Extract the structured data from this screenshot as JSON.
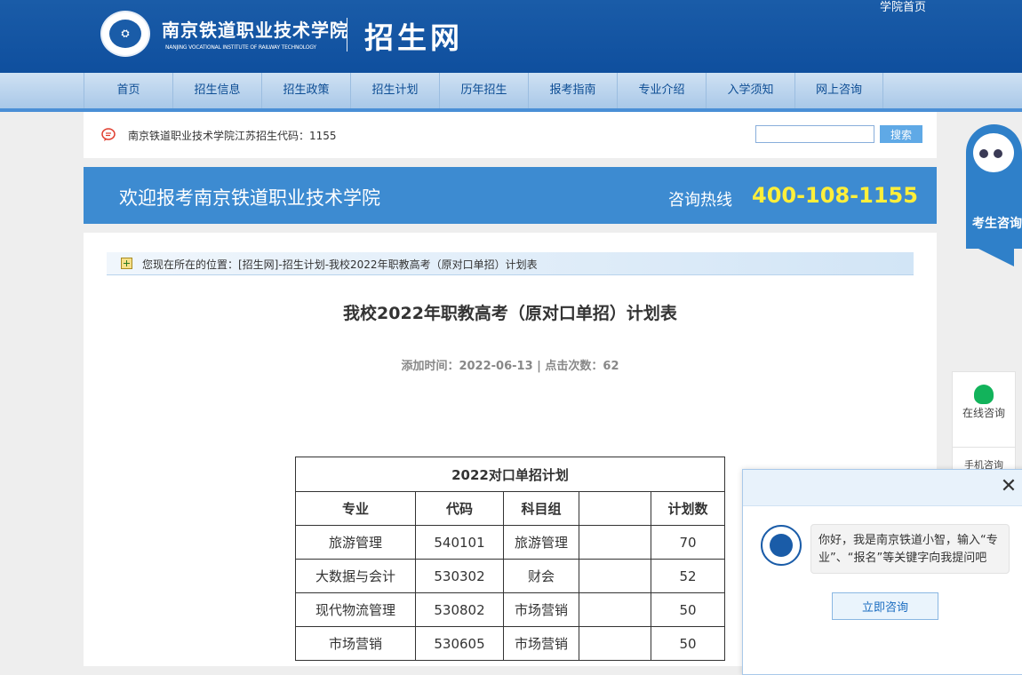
{
  "header": {
    "logo_icon": "school-seal-icon",
    "school_name_cn": "南京铁道职业技术学院",
    "school_name_en": "NANJING VOCATIONAL INSTITUTE OF RAILWAY TECHNOLOGY",
    "site_name": "招生网",
    "home_link": "学院首页"
  },
  "nav": {
    "items": [
      "首页",
      "招生信息",
      "招生政策",
      "招生计划",
      "历年招生",
      "报考指南",
      "专业介绍",
      "入学须知",
      "网上咨询"
    ]
  },
  "notice": {
    "icon": "speech-bubble-icon",
    "text": "南京铁道职业技术学院江苏招生代码：1155",
    "search_placeholder": "",
    "search_button": "搜索"
  },
  "banner": {
    "title": "欢迎报考南京铁道职业技术学院",
    "hotline_label": "咨询热线",
    "hotline_number": "400-108-1155"
  },
  "breadcrumb": {
    "icon": "plus-folder-icon",
    "text": "您现在所在的位置：[招生网]-招生计划-我校2022年职教高考（原对口单招）计划表"
  },
  "article": {
    "title": "我校2022年职教高考（原对口单招）计划表",
    "meta": "添加时间：2022-06-13 | 点击次数：62"
  },
  "table": {
    "caption": "2022对口单招计划",
    "headers": [
      "专业",
      "代码",
      "科目组",
      "",
      "计划数"
    ],
    "rows": [
      [
        "旅游管理",
        "540101",
        "旅游管理",
        "",
        "70"
      ],
      [
        "大数据与会计",
        "530302",
        "财会",
        "",
        "52"
      ],
      [
        "现代物流管理",
        "530802",
        "市场营销",
        "",
        "50"
      ],
      [
        "市场营销",
        "530605",
        "市场营销",
        "",
        "50"
      ]
    ]
  },
  "side_tab": {
    "icon": "robot-icon",
    "label": "考生咨询"
  },
  "online": {
    "icon": "chat-person-icon",
    "label": "在线咨询",
    "qr_label": "手机咨询"
  },
  "chat": {
    "close_icon": "close-icon",
    "avatar_icon": "school-seal-icon",
    "message": "你好，我是南京铁道小智，输入“专业”、“报名”等关键字向我提问吧",
    "button": "立即咨询"
  }
}
